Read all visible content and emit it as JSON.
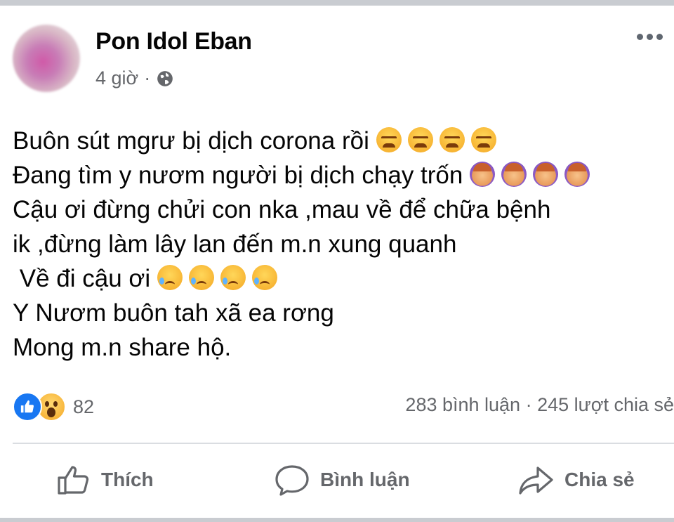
{
  "post": {
    "author": "Pon Idol Eban",
    "time": "4 giờ",
    "separator": "·",
    "lines": [
      {
        "text": "Buôn sút mgrư bị dịch corona rồi ",
        "emoji": "weary",
        "emoji_count": 4
      },
      {
        "text": "Đang tìm y nươm người bị dịch chạy trốn ",
        "emoji": "facepalm",
        "emoji_count": 4
      },
      {
        "text": "Cậu ơi đừng chửi con nka ,mau về để chữa bệnh",
        "emoji": "",
        "emoji_count": 0
      },
      {
        "text": "ik ,đừng làm lây lan đến m.n xung quanh",
        "emoji": "",
        "emoji_count": 0
      },
      {
        "text": " Về đi cậu ơi ",
        "emoji": "sad-tear",
        "emoji_count": 4
      },
      {
        "text": "Y Nươm buôn tah xã ea rơng",
        "emoji": "",
        "emoji_count": 0
      },
      {
        "text": "Mong m.n share hộ.",
        "emoji": "",
        "emoji_count": 0
      }
    ]
  },
  "reactions": {
    "icons": [
      "like-icon",
      "wow-icon"
    ],
    "count": "82",
    "comments": "283 bình luận",
    "dot": "·",
    "shares": "245 lượt chia sẻ"
  },
  "actions": {
    "like": "Thích",
    "comment": "Bình luận",
    "share": "Chia sẻ"
  },
  "colors": {
    "like_blue": "#1877f2",
    "secondary_text": "#65676b",
    "primary_text": "#050505"
  }
}
